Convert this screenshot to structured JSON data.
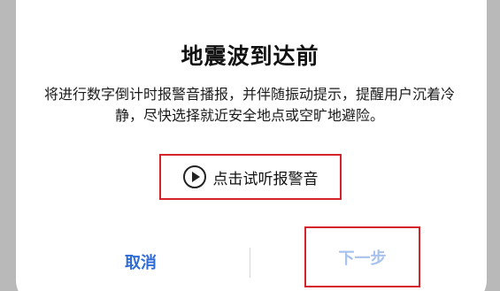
{
  "dialog": {
    "title": "地震波到达前",
    "description": "将进行数字倒计时报警音播报，并伴随振动提示，提醒用户沉着冷静，尽快选择就近安全地点或空旷地避险。",
    "preview_button": {
      "icon": "play-circle-icon",
      "label": "点击试听报警音"
    },
    "actions": {
      "cancel_label": "取消",
      "next_label": "下一步"
    }
  },
  "colors": {
    "accent": "#2e6bd6",
    "disabled_accent": "#a8c2ee",
    "highlight_box": "#d4232a",
    "backdrop": "#b9b9b9"
  }
}
